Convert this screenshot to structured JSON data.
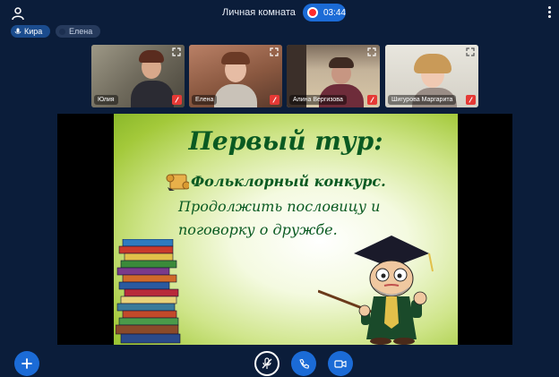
{
  "header": {
    "room_title": "Личная комната",
    "record_time": "03:44"
  },
  "speakers": [
    {
      "name": "Кира",
      "active": true
    },
    {
      "name": "Елена",
      "active": false
    }
  ],
  "participants": [
    {
      "name": "Юлия",
      "mic": "muted"
    },
    {
      "name": "Елена",
      "mic": "muted"
    },
    {
      "name": "Алина Вергизова",
      "mic": "muted"
    },
    {
      "name": "Шигурова Маргарита",
      "mic": "muted"
    }
  ],
  "slide": {
    "title": "Первый тур:",
    "line1": "Фольклорный конкурс.",
    "line2": "Продолжить пословицу и",
    "line3": "поговорку о дружбе."
  },
  "icons": {
    "add": "plus-icon",
    "mic": "microphone-muted-icon",
    "call": "phone-icon",
    "video": "camera-icon",
    "expand": "expand-icon",
    "user": "user-icon",
    "menu": "more-vertical-icon"
  },
  "colors": {
    "background": "#0b1d3a",
    "accent": "#1b6bd6",
    "record": "#ff2b2b",
    "muted": "#e53935",
    "slide_text": "#0a5a22"
  }
}
